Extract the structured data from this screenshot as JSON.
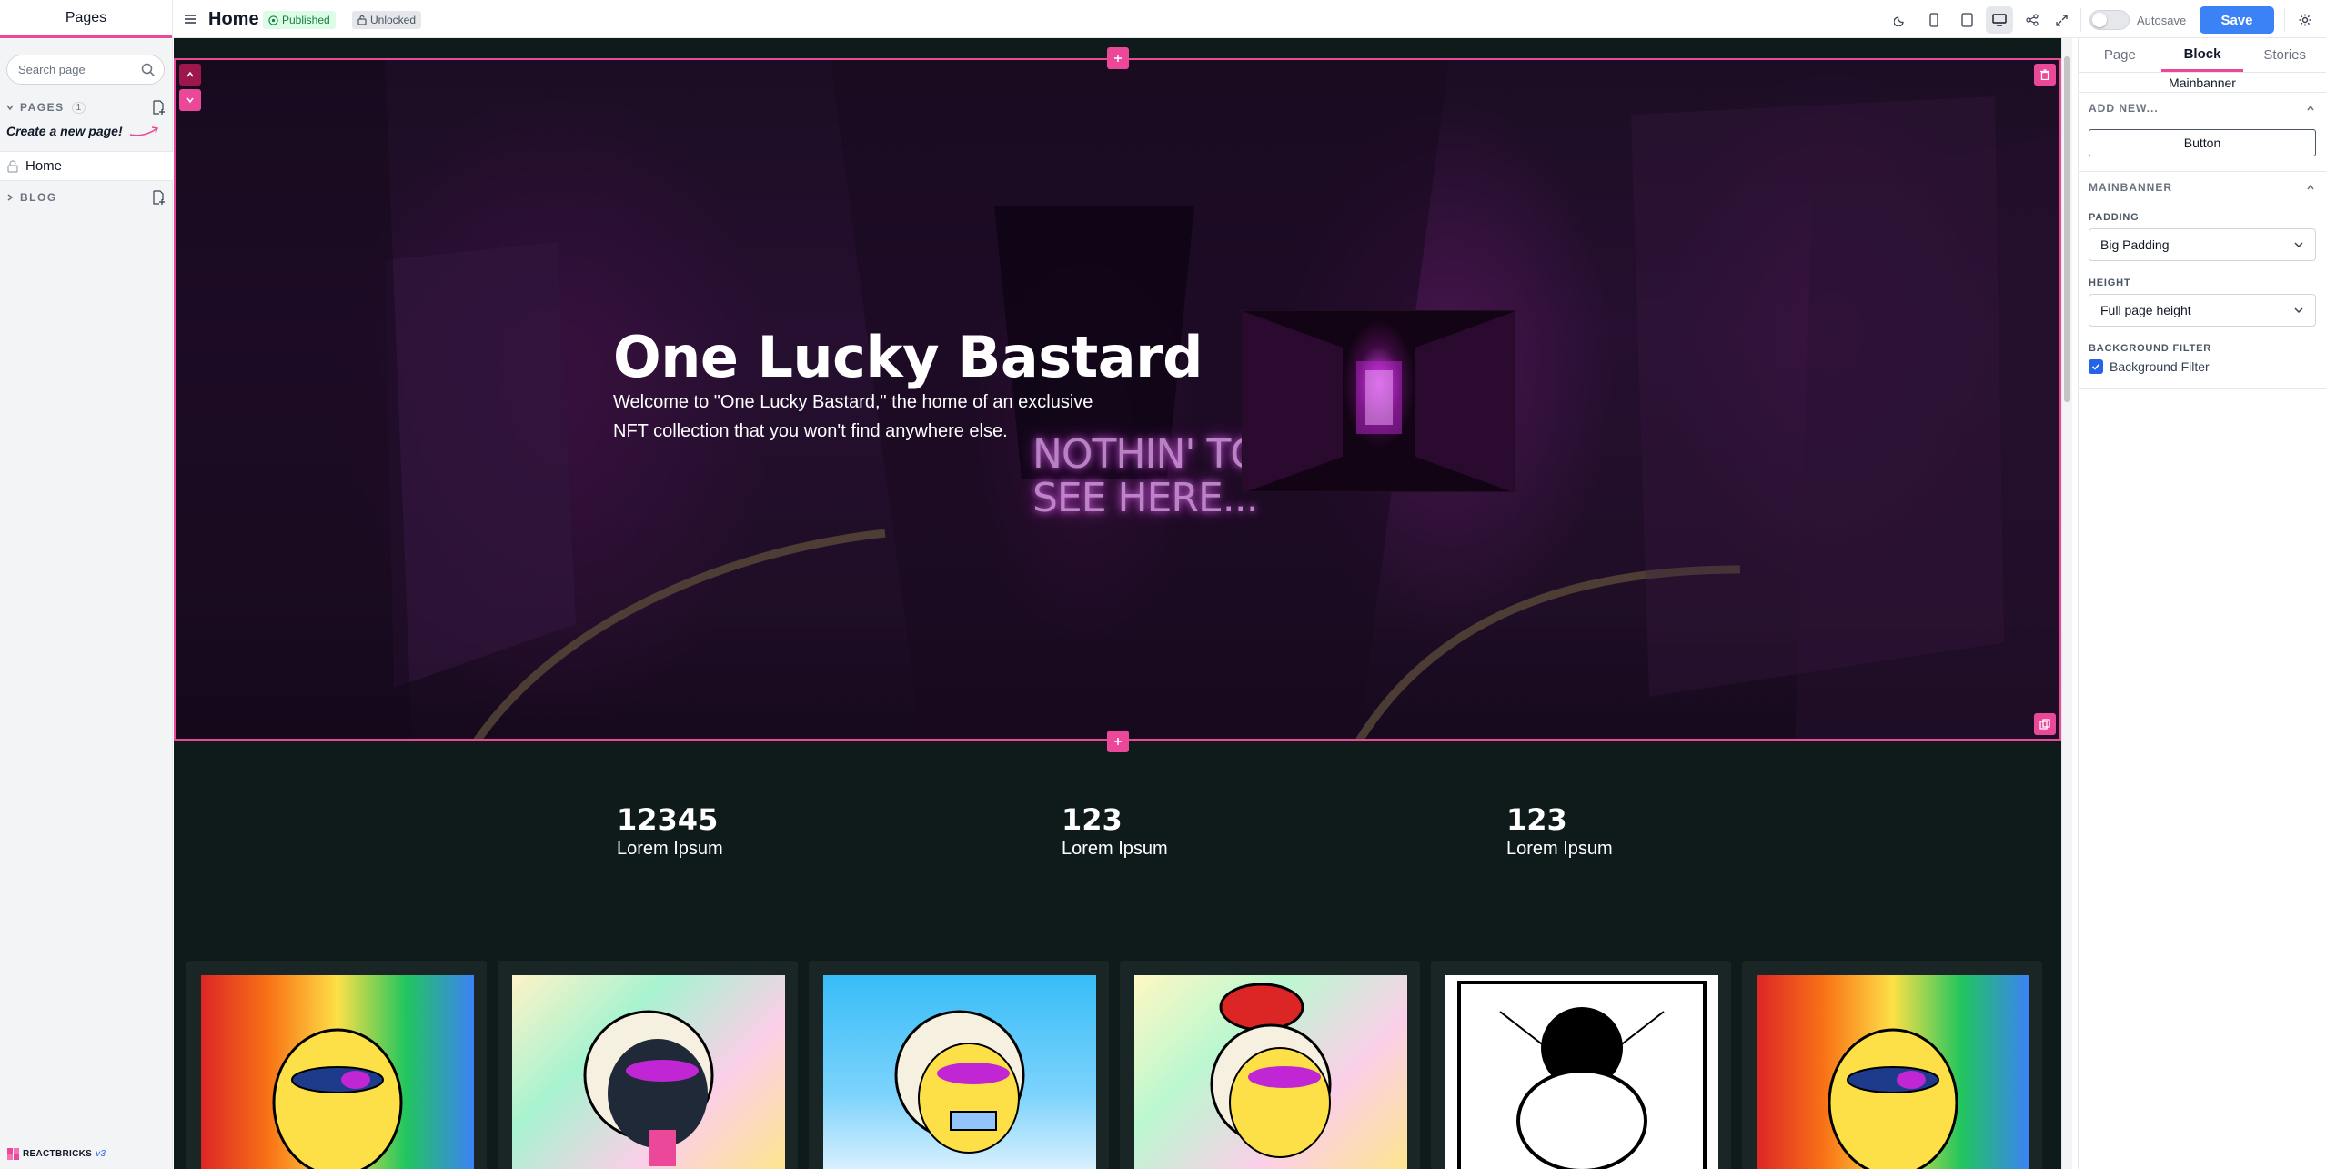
{
  "sidebar": {
    "title": "Pages",
    "search_placeholder": "Search page",
    "pages_section": {
      "label": "PAGES",
      "count": "1"
    },
    "create_hint": "Create a new page!",
    "pages": [
      {
        "label": "Home"
      }
    ],
    "blog_section": {
      "label": "BLOG"
    },
    "footer": {
      "brand": "REACTBRICKS",
      "version": "v3"
    }
  },
  "topbar": {
    "page_title": "Home",
    "status_published": "Published",
    "status_lock": "Unlocked",
    "autosave_label": "Autosave",
    "save_label": "Save",
    "accent_color": "#ec4899",
    "save_color": "#3b82f6"
  },
  "banner": {
    "title": "One Lucky Bastard",
    "text": "Welcome to \"One Lucky Bastard,\" the home of an exclusive NFT collection that you won't find anywhere else.",
    "neon_line1": "NOTHIN' TO",
    "neon_line2": "SEE HERE..."
  },
  "stats": [
    {
      "number": "12345",
      "label": "Lorem Ipsum"
    },
    {
      "number": "123",
      "label": "Lorem Ipsum"
    },
    {
      "number": "123",
      "label": "Lorem Ipsum"
    }
  ],
  "right_panel": {
    "tabs": [
      "Page",
      "Block",
      "Stories"
    ],
    "active_tab": "Block",
    "block_name": "Mainbanner",
    "add_new_label": "ADD NEW...",
    "add_button_label": "Button",
    "section_label": "MAINBANNER",
    "padding_label": "PADDING",
    "padding_value": "Big Padding",
    "height_label": "HEIGHT",
    "height_value": "Full page height",
    "bgfilter_label": "BACKGROUND FILTER",
    "bgfilter_checkbox": "Background Filter",
    "bgfilter_checked": true
  }
}
